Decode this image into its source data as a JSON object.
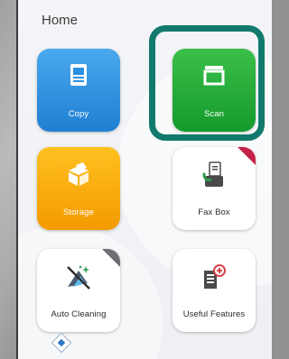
{
  "screen": {
    "title": "Home"
  },
  "tiles": [
    {
      "label": "Copy",
      "icon": "copy-document-icon",
      "color": "#2b8fe0"
    },
    {
      "label": "Scan",
      "icon": "scan-window-icon",
      "color": "#1fae3a"
    },
    {
      "label": "Storage",
      "icon": "storage-box-icon",
      "color": "#f7a90d"
    },
    {
      "label": "Fax Box",
      "icon": "fax-box-icon",
      "color": "#ffffff"
    },
    {
      "label": "Auto Cleaning",
      "icon": "auto-cleaning-icon",
      "color": "#ffffff"
    },
    {
      "label": "Useful Features",
      "icon": "useful-features-icon",
      "color": "#ffffff"
    }
  ],
  "highlight_color": "#117a6c"
}
